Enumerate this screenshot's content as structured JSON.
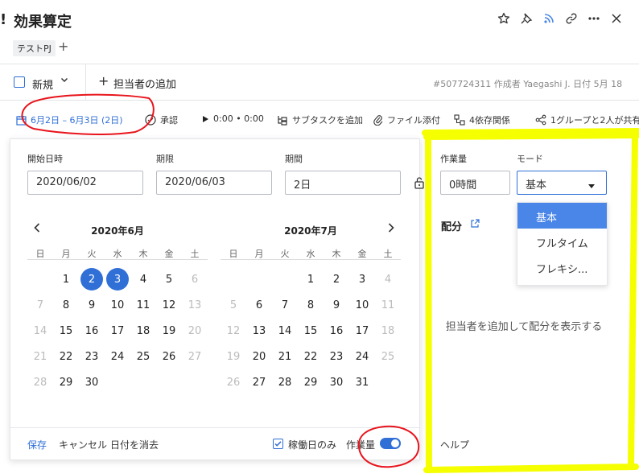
{
  "header": {
    "prefix": "!",
    "title": "効果算定",
    "tag": "テストPJ",
    "add_tag": "+"
  },
  "row2": {
    "new_label": "新規",
    "add_assignee_plus": "+",
    "add_assignee": "担当者の追加",
    "meta": "#507724311 作成者 Yaegashi J. 日付 5月 18"
  },
  "toolbar": {
    "dates": "6月2日 – 6月3日 (2日)",
    "approve": "承認",
    "timer": "0:00 • 0:00",
    "subtask": "サブタスクを追加",
    "attach": "ファイル添付",
    "deps": "4依存関係",
    "share": "1グループと2人が共有"
  },
  "dates": {
    "start_label": "開始日時",
    "start_value": "2020/06/02",
    "due_label": "期限",
    "due_value": "2020/06/03",
    "duration_label": "期間",
    "duration_value": "2日"
  },
  "calendar": {
    "dow": [
      "日",
      "月",
      "火",
      "水",
      "木",
      "金",
      "土"
    ],
    "months": [
      {
        "title": "2020年6月",
        "days": [
          "",
          "1",
          "2",
          "3",
          "4",
          "5",
          "6",
          "7",
          "8",
          "9",
          "10",
          "11",
          "12",
          "13",
          "14",
          "15",
          "16",
          "17",
          "18",
          "19",
          "20",
          "21",
          "22",
          "23",
          "24",
          "25",
          "26",
          "27",
          "28",
          "29",
          "30",
          "",
          "",
          "",
          ""
        ],
        "selected": [
          "2",
          "3"
        ]
      },
      {
        "title": "2020年7月",
        "days": [
          "",
          "",
          "",
          "1",
          "2",
          "3",
          "4",
          "5",
          "6",
          "7",
          "8",
          "9",
          "10",
          "11",
          "12",
          "13",
          "14",
          "15",
          "16",
          "17",
          "18",
          "19",
          "20",
          "21",
          "22",
          "23",
          "24",
          "25",
          "26",
          "27",
          "28",
          "29",
          "30",
          "31",
          ""
        ],
        "selected": []
      }
    ]
  },
  "footer": {
    "save": "保存",
    "cancel": "キャンセル",
    "clear": "日付を消去",
    "working_days": "稼働日のみ",
    "effort_toggle": "作業量",
    "working_days_checked": true,
    "effort_on": true
  },
  "effort_panel": {
    "effort_label": "作業量",
    "effort_value": "0時間",
    "mode_label": "モード",
    "mode_value": "基本",
    "mode_options": [
      "基本",
      "フルタイム",
      "フレキシ..."
    ],
    "allocation_label": "配分",
    "empty_message": "担当者を追加して配分を表示する",
    "help": "ヘルプ"
  },
  "colors": {
    "accent": "#2f6fd6",
    "dropdown_selected": "#4a86e8",
    "annotation_red": "#e8141c",
    "annotation_yellow": "#f5ff00"
  }
}
